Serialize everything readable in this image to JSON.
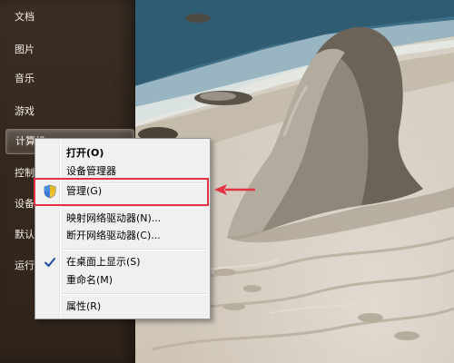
{
  "start_menu": {
    "items": [
      {
        "label": "文档"
      },
      {
        "label": "图片"
      },
      {
        "label": "音乐"
      },
      {
        "label": "游戏"
      },
      {
        "label": "计算机"
      },
      {
        "label": "控制"
      },
      {
        "label": "设备"
      },
      {
        "label": "默认"
      },
      {
        "label": "运行"
      }
    ]
  },
  "context_menu": {
    "items": [
      {
        "label": "打开(O)",
        "bold": true
      },
      {
        "label": "设备管理器"
      },
      {
        "label": "管理(G)",
        "icon": "uac-shield-icon"
      },
      {
        "label": "映射网络驱动器(N)..."
      },
      {
        "label": "断开网络驱动器(C)..."
      },
      {
        "label": "在桌面上显示(S)",
        "checked": true
      },
      {
        "label": "重命名(M)"
      },
      {
        "label": "属性(R)"
      }
    ]
  },
  "annotation": {
    "color": "#e33244",
    "target": "管理(G)"
  }
}
